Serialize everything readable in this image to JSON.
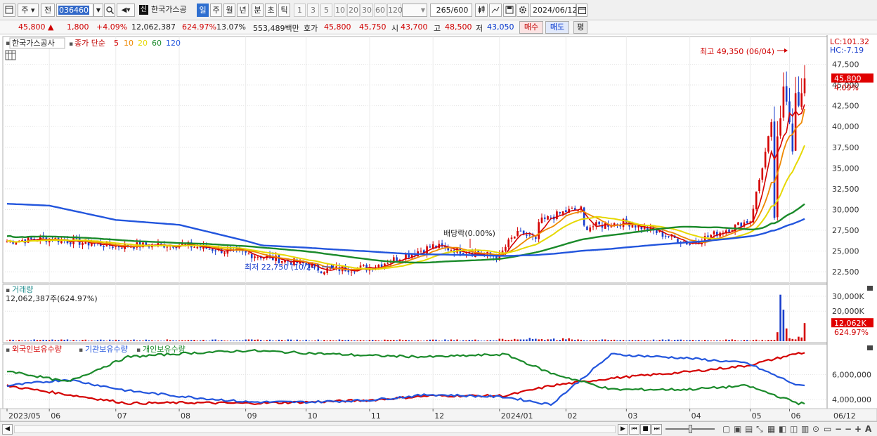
{
  "toolbar": {
    "period_label": "주",
    "prev_label": "전",
    "code_value": "036460",
    "stock_name": "한국가스공",
    "sin_badge": "신",
    "timeframes": [
      "일",
      "주",
      "월",
      "년",
      "분",
      "초",
      "틱"
    ],
    "active_timeframe": "일",
    "minute_options": [
      "1",
      "3",
      "5",
      "10",
      "20",
      "30",
      "60",
      "120"
    ],
    "count_display": "265",
    "count_total": "/600",
    "date_value": "2024/06/12"
  },
  "quote": {
    "price": "45,800",
    "arrow": "▲",
    "change": "1,800",
    "change_rate": "+4.09%",
    "volume": "12,062,387",
    "volume_rate": "624.97%",
    "turnover": "13.07%",
    "amount": "553,489백만",
    "hoga_label": "호가",
    "ask": "45,800",
    "bid": "45,750",
    "open_label": "시",
    "open": "43,700",
    "high_label": "고",
    "high": "48,500",
    "low_label": "저",
    "low": "43,050",
    "buy_label": "매수",
    "sell_label": "매도",
    "eval_label": "평"
  },
  "price_panel": {
    "stock": "한국가스공사",
    "ma_title": "종가 단순",
    "ma_periods": [
      "5",
      "10",
      "20",
      "60",
      "120"
    ],
    "ma_colors": [
      "#d40000",
      "#ee8800",
      "#e6d800",
      "#1a8a2a",
      "#2255dd"
    ],
    "lc_label": "LC:101.32",
    "hc_label": "HC:-7.19",
    "price_tag": "45,800",
    "price_tag_rate": "4.09%",
    "high_annotation": "최고 49,350 (06/04)",
    "low_annotation": "최저 22,750 (10/24)",
    "dividend_annotation": "배당락(0.00%)",
    "y_ticks": [
      "47,500",
      "45,000",
      "42,500",
      "40,000",
      "37,500",
      "35,000",
      "32,500",
      "30,000",
      "27,500",
      "25,000",
      "22,500"
    ]
  },
  "volume_panel": {
    "title": "거래량",
    "value_text": "12,062,387주(624.97%)",
    "y_ticks": [
      "30,000K",
      "20,000K"
    ],
    "tag": "12,062K",
    "tag_rate": "624.97%"
  },
  "holding_panel": {
    "titles": [
      "외국인보유수량",
      "기관보유수량",
      "개인보유수량"
    ],
    "colors": [
      "#d40000",
      "#2255dd",
      "#1a8a2a"
    ],
    "y_ticks": [
      "6,000,000",
      "4,000,000"
    ]
  },
  "x_axis": {
    "labels": [
      "2023/05",
      "06",
      "07",
      "08",
      "09",
      "10",
      "11",
      "12",
      "2024/01",
      "02",
      "03",
      "04",
      "05",
      "06",
      "06/12"
    ]
  },
  "chart_data": {
    "type": "line",
    "candles_ohlc_description": "daily candlesticks 2023/05 - 2024/06/12",
    "ylim": [
      21500,
      50500
    ],
    "price_series": [
      {
        "date": "2023/05",
        "close": 26200
      },
      {
        "date": "06",
        "close": 26500
      },
      {
        "date": "07",
        "close": 25600
      },
      {
        "date": "08",
        "close": 25800
      },
      {
        "date": "09",
        "close": 24700
      },
      {
        "date": "10",
        "close": 23400
      },
      {
        "date": "10/24",
        "close": 22750
      },
      {
        "date": "11",
        "close": 23000
      },
      {
        "date": "12",
        "close": 25600
      },
      {
        "date": "2024/01",
        "close": 24300
      },
      {
        "date": "02",
        "close": 27600
      },
      {
        "date": "03",
        "close": 28500
      },
      {
        "date": "04",
        "close": 25900
      },
      {
        "date": "05",
        "close": 28700
      },
      {
        "date": "06/04",
        "close": 45000
      },
      {
        "date": "06/12",
        "close": 45800
      }
    ],
    "volume_series": [
      {
        "date": "06/03",
        "value": 6000
      },
      {
        "date": "06/04",
        "value": 31000
      },
      {
        "date": "06/05",
        "value": 21000
      },
      {
        "date": "06/07",
        "value": 2000
      },
      {
        "date": "06/12",
        "value": 12062
      }
    ],
    "holding_series": [
      {
        "name": "외국인보유수량",
        "values": [
          5100000,
          4400000,
          3700000,
          3750000,
          3700000,
          3800000,
          3950000,
          4300000,
          4300000,
          5100000,
          5700000,
          6200000,
          6700000,
          7700000
        ]
      },
      {
        "name": "기관보유수량",
        "values": [
          5100000,
          5600000,
          4700000,
          4200000,
          3800000,
          3800000,
          3950000,
          4400000,
          4200000,
          3600000,
          7600000,
          7300000,
          6900000,
          5100000
        ]
      },
      {
        "name": "개인보유수량",
        "values": [
          6300000,
          5400000,
          7400000,
          7700000,
          7900000,
          7700000,
          7500000,
          7400000,
          7600000,
          6100000,
          4800000,
          4800000,
          5100000,
          3700000
        ]
      }
    ]
  }
}
